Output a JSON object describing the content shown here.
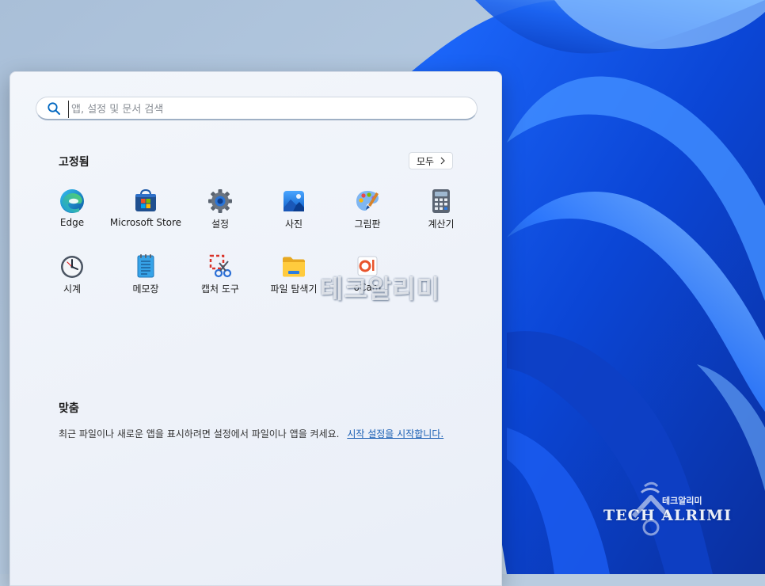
{
  "search": {
    "placeholder": "앱, 설정 및 문서 검색"
  },
  "pinned": {
    "title": "고정됨",
    "all_apps_label": "모두",
    "apps": [
      {
        "label": "Edge",
        "icon": "edge-icon"
      },
      {
        "label": "Microsoft Store",
        "icon": "microsoft-store-icon"
      },
      {
        "label": "설정",
        "icon": "settings-gear-icon"
      },
      {
        "label": "사진",
        "icon": "photos-icon"
      },
      {
        "label": "그림판",
        "icon": "paint-palette-icon"
      },
      {
        "label": "계산기",
        "icon": "calculator-icon"
      },
      {
        "label": "시계",
        "icon": "clock-icon"
      },
      {
        "label": "메모장",
        "icon": "notepad-icon"
      },
      {
        "label": "캡처 도구",
        "icon": "snipping-tool-icon"
      },
      {
        "label": "파일 탐색기",
        "icon": "file-explorer-folder-icon"
      },
      {
        "label": "oCam",
        "icon": "ocam-icon"
      }
    ]
  },
  "recommended": {
    "title": "맞춤",
    "text": "최근 파일이나 새로운 앱을 표시하려면 설정에서 파일이나 앱을 켜세요.",
    "link": "시작 설정을 시작합니다."
  },
  "watermarks": {
    "center": "테크알리미",
    "logo_sub": "테크알리미",
    "logo_main": "TECH ALRIMI"
  },
  "colors": {
    "accent": "#0067c0",
    "link": "#1a5fb4",
    "wallpaper_blue": "#0a4fd8"
  }
}
